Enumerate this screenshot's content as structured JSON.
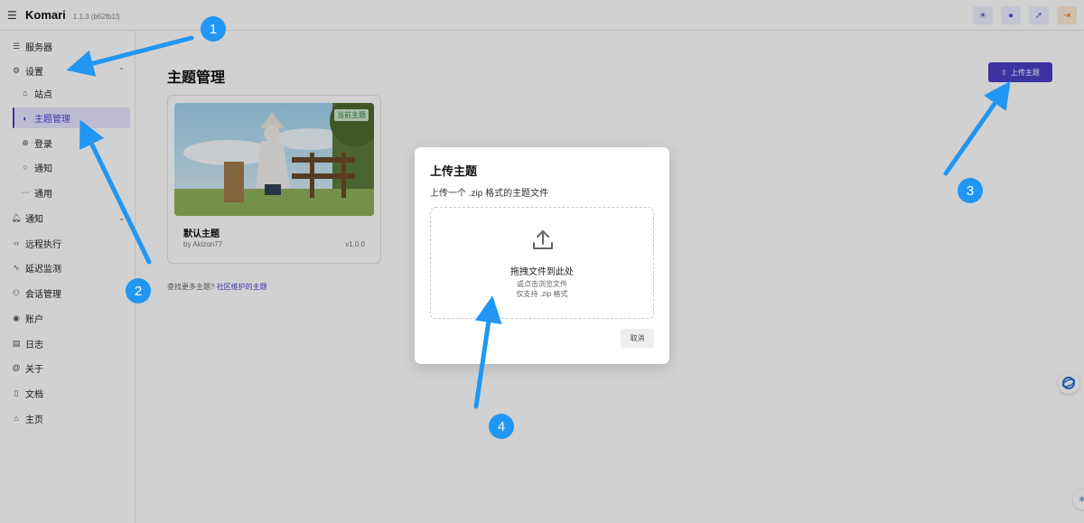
{
  "app": {
    "title": "Komari",
    "version": "1.1.3 (b62fb1f)"
  },
  "topbar": {
    "icons": [
      "sun-icon",
      "bulb-icon",
      "rocket-icon",
      "logout-icon"
    ]
  },
  "sidebar": {
    "items": [
      {
        "label": "服务器",
        "icon": "server-icon"
      },
      {
        "label": "设置",
        "icon": "gear-icon",
        "expanded": true
      },
      {
        "label": "站点",
        "icon": "home-icon"
      },
      {
        "label": "主题管理",
        "icon": "palette-icon",
        "active": true
      },
      {
        "label": "登录",
        "icon": "login-icon"
      },
      {
        "label": "通知",
        "icon": "chat-icon"
      },
      {
        "label": "通用",
        "icon": "dots-icon"
      },
      {
        "label": "通知",
        "icon": "bell-icon"
      },
      {
        "label": "远程执行",
        "icon": "code-icon"
      },
      {
        "label": "延迟监测",
        "icon": "pulse-icon"
      },
      {
        "label": "会话管理",
        "icon": "users-icon"
      },
      {
        "label": "账户",
        "icon": "user-circle-icon"
      },
      {
        "label": "日志",
        "icon": "file-icon"
      },
      {
        "label": "关于",
        "icon": "at-icon"
      },
      {
        "label": "文档",
        "icon": "book-icon"
      },
      {
        "label": "主页",
        "icon": "home-icon"
      }
    ]
  },
  "main": {
    "title": "主题管理",
    "upload_button": "上传主题",
    "theme_card": {
      "badge": "当前主题",
      "name": "默认主题",
      "author": "by Akizon77",
      "version": "v1.0.0"
    },
    "more_text": "查找更多主题?",
    "more_link": "社区维护的主题"
  },
  "modal": {
    "title": "上传主题",
    "description": "上传一个 .zip 格式的主题文件",
    "dropzone": {
      "main": "拖拽文件到此处",
      "sub1": "或点击浏览文件",
      "sub2": "仅支持 .zip 格式"
    },
    "cancel": "取消"
  },
  "annotations": [
    "1",
    "2",
    "3",
    "4"
  ]
}
